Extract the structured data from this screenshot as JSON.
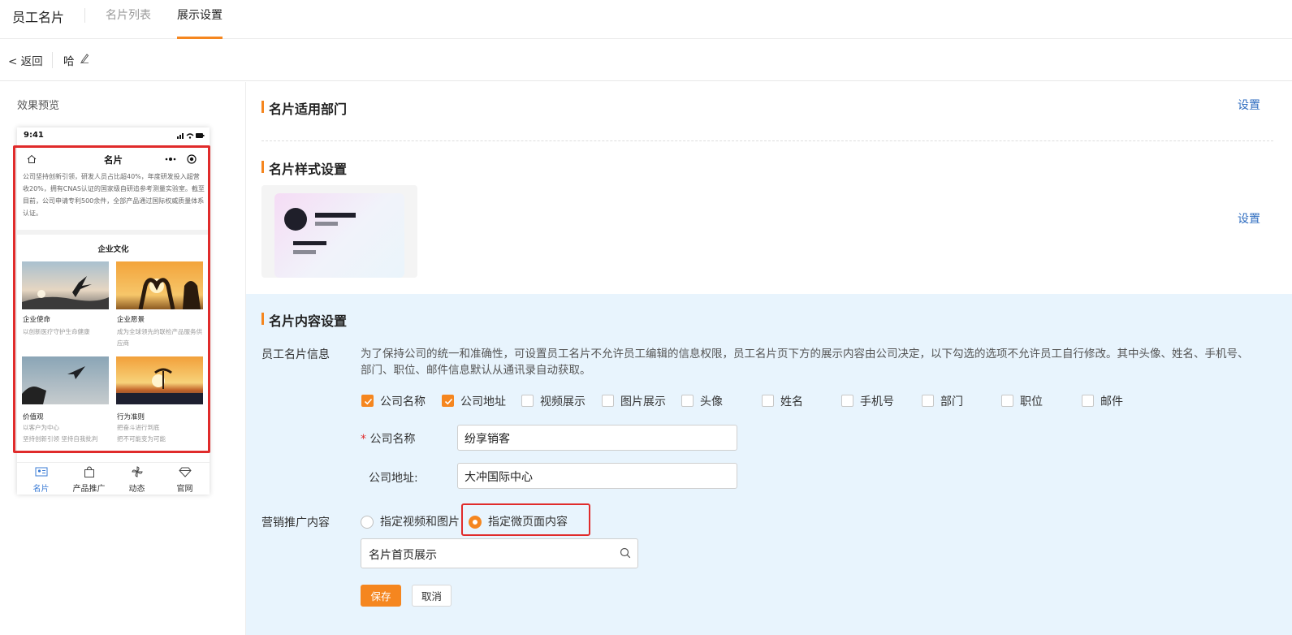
{
  "header": {
    "app_title": "员工名片",
    "tabs": [
      {
        "label": "名片列表",
        "active": false
      },
      {
        "label": "展示设置",
        "active": true
      }
    ],
    "accent_color": "#f5861f"
  },
  "subheader": {
    "back_label": "< 返回",
    "card_name": "哈"
  },
  "preview": {
    "label": "效果预览",
    "phone": {
      "time": "9:41",
      "title": "名片",
      "intro": "公司坚持创新引领，研发人员占比超40%，年度研发投入超营收20%，拥有CNAS认证的国家级自研追参考测量实验室。截至目前，公司申请专利500余件，全部产品通过国际权威质量体系认证。",
      "section_title": "企业文化",
      "cards": [
        {
          "caption": "企业使命",
          "desc": "以创新医疗守护生命健康"
        },
        {
          "caption": "企业愿景",
          "desc": "成为全球领先的联检产品服务供应商"
        },
        {
          "caption": "价值观",
          "desc": "以客户为中心\n坚持创新引领 坚持自我批判"
        },
        {
          "caption": "行为准则",
          "desc": "把奋斗进行到底\n把不可能变为可能"
        }
      ],
      "tabbar": [
        {
          "label": "名片",
          "icon": "id-card-icon",
          "active": true
        },
        {
          "label": "产品推广",
          "icon": "bag-icon",
          "active": false
        },
        {
          "label": "动态",
          "icon": "pinwheel-icon",
          "active": false
        },
        {
          "label": "官网",
          "icon": "diamond-icon",
          "active": false
        }
      ]
    }
  },
  "sections": {
    "dept": {
      "title": "名片适用部门",
      "set_label": "设置"
    },
    "style": {
      "title": "名片样式设置",
      "set_label": "设置"
    },
    "content": {
      "title": "名片内容设置",
      "info_label": "员工名片信息",
      "info_desc": "为了保持公司的统一和准确性，可设置员工名片不允许员工编辑的信息权限，员工名片页下方的展示内容由公司决定，以下勾选的选项不允许员工自行修改。其中头像、姓名、手机号、部门、职位、邮件信息默认从通讯录自动获取。",
      "options": [
        {
          "label": "公司名称",
          "checked": true
        },
        {
          "label": "公司地址",
          "checked": true
        },
        {
          "label": "视频展示",
          "checked": false
        },
        {
          "label": "图片展示",
          "checked": false
        },
        {
          "label": "头像",
          "checked": false
        },
        {
          "label": "姓名",
          "checked": false
        },
        {
          "label": "手机号",
          "checked": false
        },
        {
          "label": "部门",
          "checked": false
        },
        {
          "label": "职位",
          "checked": false
        },
        {
          "label": "邮件",
          "checked": false
        }
      ],
      "company_name_label": "公司名称",
      "company_name_value": "纷享销客",
      "company_addr_label": "公司地址:",
      "company_addr_value": "大冲国际中心",
      "marketing_label": "营销推广内容",
      "radio_options": [
        {
          "label": "指定视频和图片",
          "selected": false
        },
        {
          "label": "指定微页面内容",
          "selected": true
        }
      ],
      "micropage_value": "名片首页展示",
      "save_label": "保存",
      "cancel_label": "取消"
    }
  }
}
